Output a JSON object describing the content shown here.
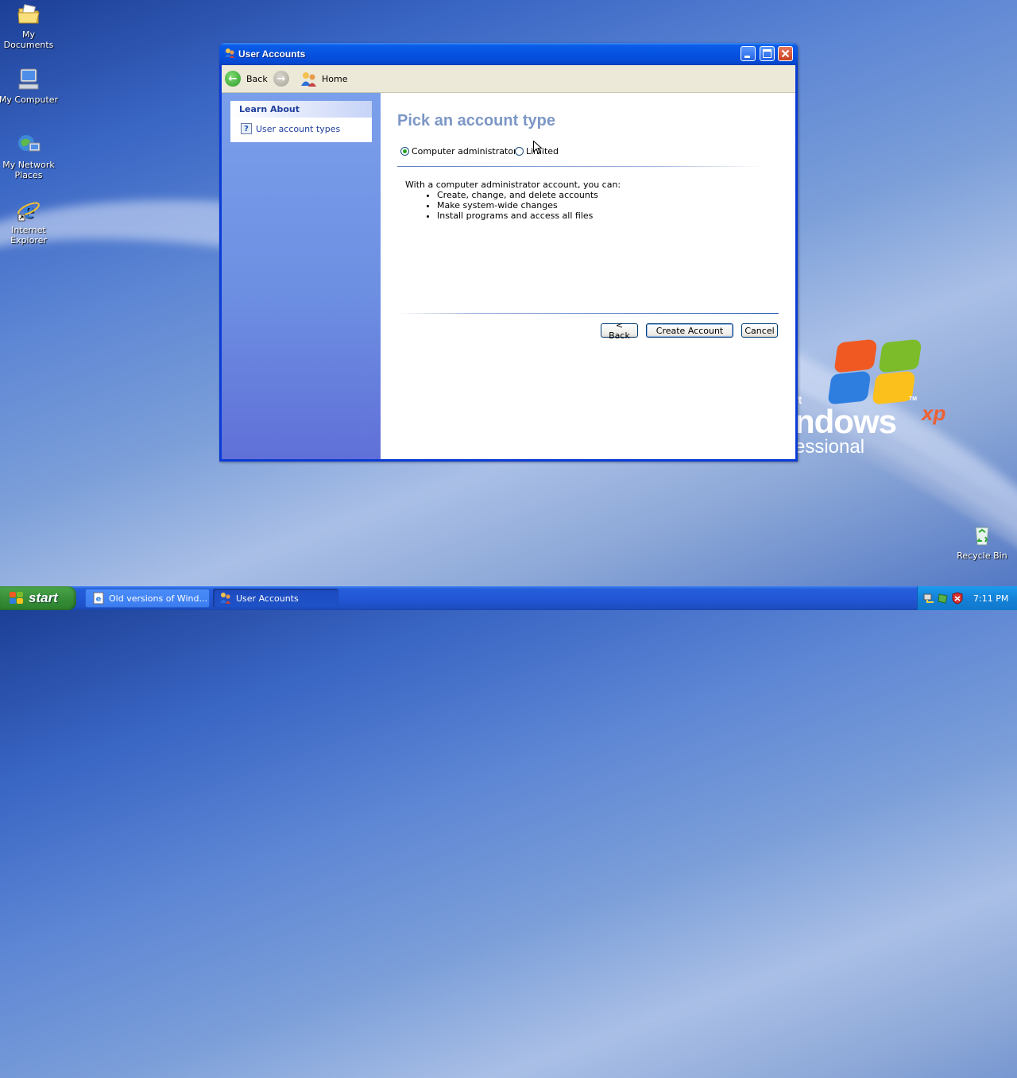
{
  "desktop": {
    "icons": [
      {
        "label": "My Documents",
        "icon": "folder-icon"
      },
      {
        "label": "My Computer",
        "icon": "computer-icon"
      },
      {
        "label": "My Network Places",
        "icon": "network-icon"
      },
      {
        "label": "Internet Explorer",
        "icon": "internet-explorer-icon"
      },
      {
        "label": "Recycle Bin",
        "icon": "recycle-bin-icon"
      }
    ],
    "wallpaper_text": {
      "line1": "ft",
      "line2": "ndows",
      "xp": "xp",
      "tm": "TM",
      "line3": "essional"
    }
  },
  "window": {
    "title": "User Accounts",
    "toolbar": {
      "back_label": "Back",
      "home_label": "Home"
    },
    "sidebar": {
      "header": "Learn About",
      "items": [
        {
          "label": "User account types"
        }
      ]
    },
    "main": {
      "heading": "Pick an account type",
      "radio_options": [
        {
          "label": "Computer administrator",
          "selected": true
        },
        {
          "label": "Limited",
          "selected": false
        }
      ],
      "description_intro": "With a computer administrator account, you can:",
      "bullets": [
        "Create, change, and delete accounts",
        "Make system-wide changes",
        "Install programs and access all files"
      ],
      "buttons": {
        "back": "< Back",
        "create": "Create Account",
        "cancel": "Cancel"
      }
    }
  },
  "taskbar": {
    "start_label": "start",
    "tasks": [
      {
        "label": "Old versions of Wind...",
        "active": false
      },
      {
        "label": "User Accounts",
        "active": true
      }
    ],
    "clock": "7:11 PM"
  },
  "colors": {
    "titlebar": "#0553e0",
    "heading": "#7c97c6",
    "sidebar": "#7a9fea",
    "taskbar": "#245edb",
    "start_button": "#3a913a"
  }
}
